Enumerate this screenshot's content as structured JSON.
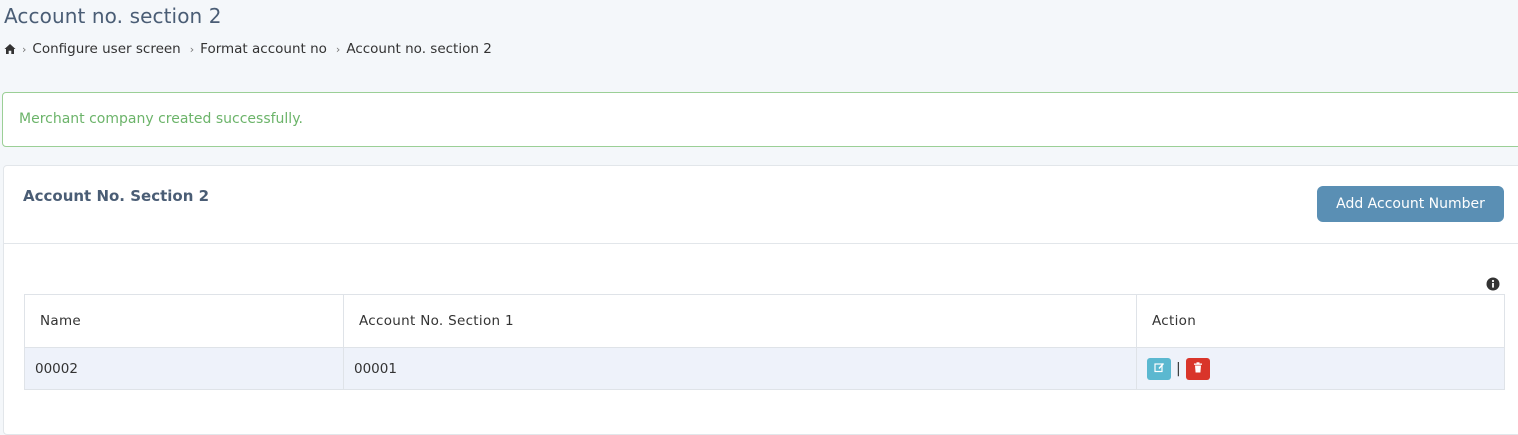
{
  "page": {
    "title": "Account no. section 2"
  },
  "breadcrumb": {
    "home_icon": "home-icon",
    "items": [
      "Configure user screen",
      "Format account no",
      "Account no. section 2"
    ]
  },
  "alert": {
    "message": "Merchant company created successfully.",
    "color": "#6cb46a"
  },
  "card": {
    "title": "Account No. Section 2",
    "add_button_label": "Add Account Number",
    "accent_color": "#5a8fb4"
  },
  "table": {
    "headers": [
      "Name",
      "Account No. Section 1",
      "Action"
    ],
    "rows": [
      {
        "name": "00002",
        "section1": "00001",
        "separator": "|"
      }
    ]
  },
  "icons": {
    "info": "info-circle-icon",
    "edit": "edit-icon",
    "delete": "trash-icon"
  }
}
